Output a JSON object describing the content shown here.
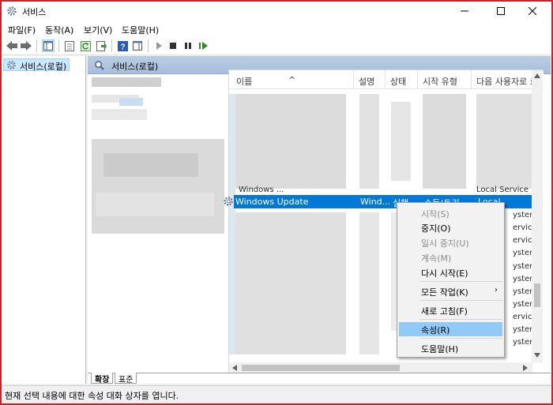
{
  "window": {
    "title": "서비스",
    "icon": "gear-icon",
    "controls": [
      "minimize-icon",
      "maximize-icon",
      "close-icon"
    ]
  },
  "menu": [
    "파일(F)",
    "동작(A)",
    "보기(V)",
    "도움말(H)"
  ],
  "tree": {
    "item": "서비스(로컬)"
  },
  "pane_header": "서비스(로컬)",
  "columns": {
    "name": "이름",
    "description": "설명",
    "status": "상태",
    "startup": "시작 유형",
    "logon": "다음 사용자로 로"
  },
  "selected_row": {
    "name": "Windows Update",
    "description": "Wind...",
    "status": "실행",
    "startup": "수동(트리",
    "logon": "Local System"
  },
  "row_above_partial": {
    "name": "Windows ...",
    "logon": "Local Service"
  },
  "partial_logon_values": [
    "ystem",
    "ervice",
    "ervice",
    "ystem",
    "ystem",
    "ystem",
    "ystem",
    "ystem",
    "ervice",
    "ystem",
    "ystem"
  ],
  "context_menu": {
    "start": "시작(S)",
    "stop": "중지(O)",
    "pause": "일시 중지(U)",
    "resume": "계속(M)",
    "restart": "다시 시작(E)",
    "all_tasks": "모든 작업(K)",
    "refresh": "새로 고침(F)",
    "properties": "속성(R)",
    "help": "도움말(H)"
  },
  "tabs": {
    "extended": "확장",
    "standard": "표준"
  },
  "status_text": "현재 선택 내용에 대한 속성 대화 상자를 엽니다.",
  "colors": {
    "selection": "#0078d7",
    "menu_highlight": "#91c9f7",
    "frame": "#c0272d"
  }
}
